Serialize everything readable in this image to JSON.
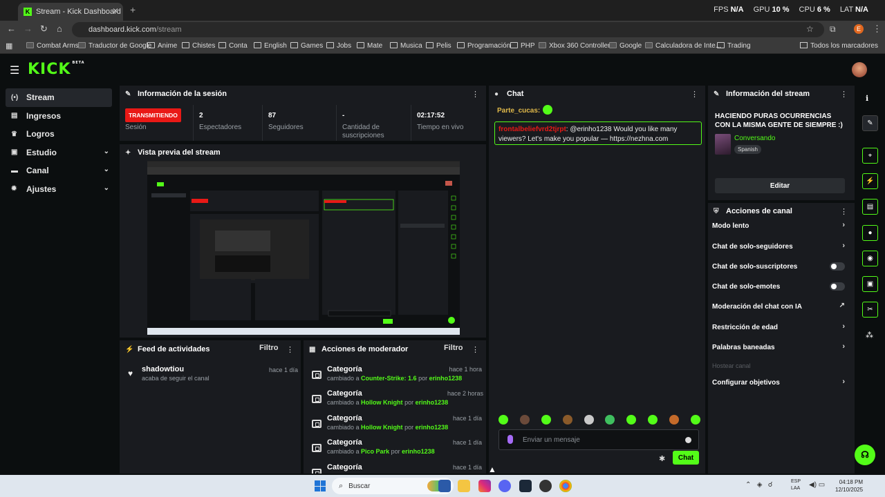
{
  "browser": {
    "tab_title": "Stream - Kick Dashboard",
    "url_host": "dashboard.kick.com",
    "url_path": "/stream",
    "overlay": {
      "fps_label": "FPS",
      "fps": "N/A",
      "gpu_label": "GPU",
      "gpu": "10 %",
      "cpu_label": "CPU",
      "cpu": "6 %",
      "lat_label": "LAT",
      "lat": "N/A"
    },
    "bookmarks": [
      "Combat Arms",
      "Traductor de Google",
      "Anime",
      "Chistes",
      "Conta",
      "English",
      "Games",
      "Jobs",
      "Mate",
      "Musica",
      "Pelis",
      "Programación",
      "PHP",
      "Xbox 360 Controller...",
      "Google",
      "Calculadora de Inte...",
      "Trading"
    ],
    "all_bookmarks": "Todos los marcadores"
  },
  "app": {
    "logo": "KICK",
    "logo_sup": "BETA",
    "sidebar": [
      {
        "label": "Stream",
        "icon": "broadcast-icon",
        "glyph": "(•)",
        "active": true,
        "expand": false
      },
      {
        "label": "Ingresos",
        "icon": "revenue-icon",
        "glyph": "▤",
        "active": false,
        "expand": false
      },
      {
        "label": "Logros",
        "icon": "trophy-icon",
        "glyph": "♛",
        "active": false,
        "expand": false
      },
      {
        "label": "Estudio",
        "icon": "studio-icon",
        "glyph": "▣",
        "active": false,
        "expand": true
      },
      {
        "label": "Canal",
        "icon": "channel-icon",
        "glyph": "▬",
        "active": false,
        "expand": true
      },
      {
        "label": "Ajustes",
        "icon": "settings-icon",
        "glyph": "✹",
        "active": false,
        "expand": true
      }
    ],
    "session": {
      "title": "Información de la sesión",
      "status": "TRANSMITIENDO",
      "status_label": "Sesión",
      "stats": [
        {
          "value": "2",
          "label": "Espectadores"
        },
        {
          "value": "87",
          "label": "Seguidores"
        },
        {
          "value": "-",
          "label": "Cantidad de suscripciones"
        },
        {
          "value": "02:17:52",
          "label": "Tiempo en vivo"
        }
      ]
    },
    "preview": {
      "title": "Vista previa del stream"
    },
    "feed": {
      "title": "Feed de actividades",
      "filter": "Filtro",
      "items": [
        {
          "user": "shadowtiou",
          "desc": "acaba de seguir el canal",
          "time": "hace 1 día"
        }
      ]
    },
    "mod_actions": {
      "title": "Acciones de moderador",
      "filter": "Filtro",
      "items": [
        {
          "title": "Categoría",
          "prefix": "cambiado a",
          "value": "Counter-Strike: 1.6",
          "by": "por",
          "user": "erinho1238",
          "time": "hace 1 hora"
        },
        {
          "title": "Categoría",
          "prefix": "cambiado a",
          "value": "Hollow Knight",
          "by": "por",
          "user": "erinho1238",
          "time": "hace 2 horas"
        },
        {
          "title": "Categoría",
          "prefix": "cambiado a",
          "value": "Hollow Knight",
          "by": "por",
          "user": "erinho1238",
          "time": "hace 1 día"
        },
        {
          "title": "Categoría",
          "prefix": "cambiado a",
          "value": "Pico Park",
          "by": "por",
          "user": "erinho1238",
          "time": "hace 1 día"
        },
        {
          "title": "Categoría",
          "prefix": "",
          "value": "",
          "by": "",
          "user": "",
          "time": "hace 1 día"
        }
      ]
    },
    "chat": {
      "title": "Chat",
      "pinned_user": "Parte_cucas:",
      "message": {
        "user": "frontalbeliefvrd2tjrpt",
        "text": ": @erinho1238 Would you like many viewers? Let's make you popular — https://nezhna.com"
      },
      "emote_colors": [
        "#53fc18",
        "#6b4a3a",
        "#53fc18",
        "#8a5a2a",
        "#c9c9c9",
        "#3fbf5f",
        "#53fc18",
        "#53fc18",
        "#c46a2a",
        "#53fc18"
      ],
      "input_placeholder": "Enviar un mensaje",
      "send_label": "Chat"
    },
    "stream_info": {
      "title": "Información del stream",
      "stream_title": "HACIENDO PURAS OCURRENCIAS CON LA MISMA GENTE DE SIEMPRE :)",
      "category": "Conversando",
      "language": "Spanish",
      "edit_label": "Editar"
    },
    "channel_actions": {
      "title": "Acciones de canal",
      "items": [
        {
          "label": "Modo lento",
          "kind": "arrow"
        },
        {
          "label": "Chat de solo-seguidores",
          "kind": "arrow"
        },
        {
          "label": "Chat de solo-suscriptores",
          "kind": "toggle"
        },
        {
          "label": "Chat de solo-emotes",
          "kind": "toggle"
        },
        {
          "label": "Moderación del chat con IA",
          "kind": "external"
        },
        {
          "label": "Restricción de edad",
          "kind": "arrow"
        },
        {
          "label": "Palabras baneadas",
          "kind": "arrow"
        },
        {
          "label": "Hostear canal",
          "kind": "disabled"
        },
        {
          "label": "Configurar objetivos",
          "kind": "arrow"
        }
      ]
    }
  },
  "taskbar": {
    "search": "Buscar",
    "lang_1": "ESP",
    "lang_2": "LAA",
    "time": "04:18 PM",
    "date": "12/10/2025"
  }
}
